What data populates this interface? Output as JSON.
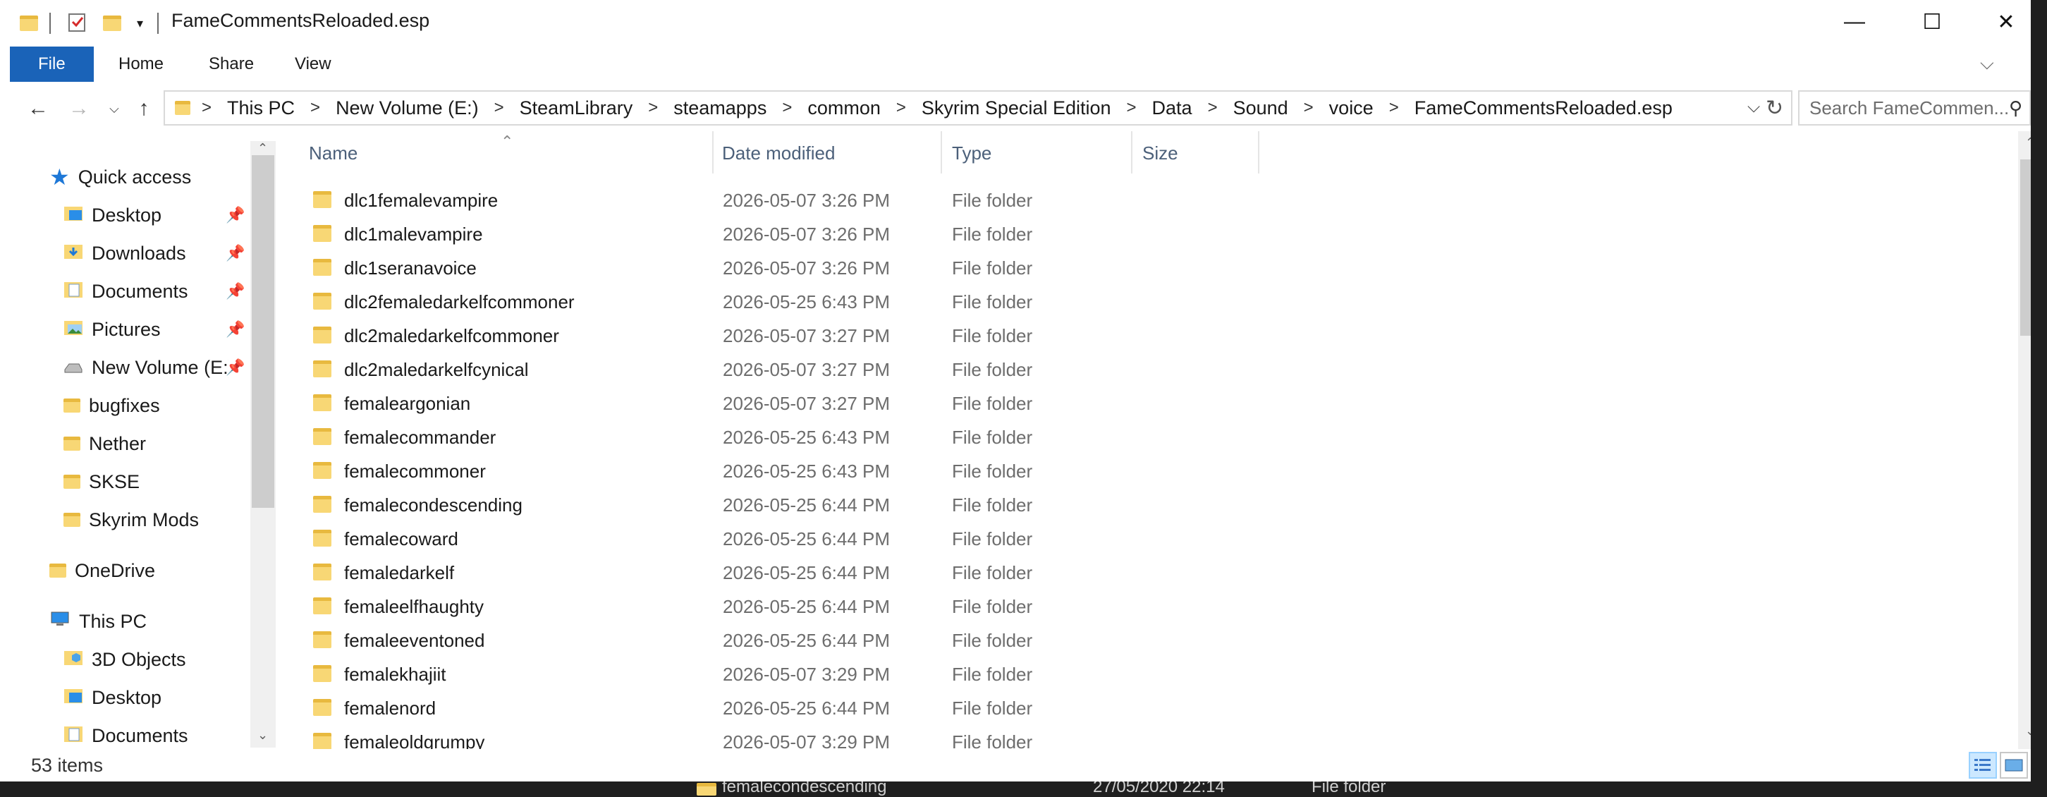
{
  "window": {
    "title": "FameCommentsReloaded.esp",
    "controls": {
      "minimize": "—",
      "maximize": "☐",
      "close": "✕"
    }
  },
  "ribbon": {
    "tabs": [
      "File",
      "Home",
      "Share",
      "View"
    ],
    "help": "?",
    "collapse": "⌵"
  },
  "address": {
    "crumbs": [
      "This PC",
      "New Volume (E:)",
      "SteamLibrary",
      "steamapps",
      "common",
      "Skyrim Special Edition",
      "Data",
      "Sound",
      "voice",
      "FameCommentsReloaded.esp"
    ],
    "separator": ">"
  },
  "search": {
    "placeholder": "Search FameCommen..."
  },
  "nav_pane": {
    "quick_access": "Quick access",
    "pinned": [
      {
        "label": "Desktop"
      },
      {
        "label": "Downloads"
      },
      {
        "label": "Documents"
      },
      {
        "label": "Pictures"
      },
      {
        "label": "New Volume (E:)"
      }
    ],
    "unpinned": [
      "bugfixes",
      "Nether",
      "SKSE",
      "Skyrim Mods"
    ],
    "onedrive": "OneDrive",
    "this_pc": "This PC",
    "this_pc_items": [
      "3D Objects",
      "Desktop",
      "Documents"
    ]
  },
  "columns": {
    "name": "Name",
    "date": "Date modified",
    "type": "Type",
    "size": "Size"
  },
  "files": [
    {
      "name": "dlc1femalevampire",
      "date": "2026-05-07 3:26 PM",
      "type": "File folder"
    },
    {
      "name": "dlc1malevampire",
      "date": "2026-05-07 3:26 PM",
      "type": "File folder"
    },
    {
      "name": "dlc1seranavoice",
      "date": "2026-05-07 3:26 PM",
      "type": "File folder"
    },
    {
      "name": "dlc2femaledarkelfcommoner",
      "date": "2026-05-25 6:43 PM",
      "type": "File folder"
    },
    {
      "name": "dlc2maledarkelfcommoner",
      "date": "2026-05-07 3:27 PM",
      "type": "File folder"
    },
    {
      "name": "dlc2maledarkelfcynical",
      "date": "2026-05-07 3:27 PM",
      "type": "File folder"
    },
    {
      "name": "femaleargonian",
      "date": "2026-05-07 3:27 PM",
      "type": "File folder"
    },
    {
      "name": "femalecommander",
      "date": "2026-05-25 6:43 PM",
      "type": "File folder"
    },
    {
      "name": "femalecommoner",
      "date": "2026-05-25 6:43 PM",
      "type": "File folder"
    },
    {
      "name": "femalecondescending",
      "date": "2026-05-25 6:44 PM",
      "type": "File folder"
    },
    {
      "name": "femalecoward",
      "date": "2026-05-25 6:44 PM",
      "type": "File folder"
    },
    {
      "name": "femaledarkelf",
      "date": "2026-05-25 6:44 PM",
      "type": "File folder"
    },
    {
      "name": "femaleelfhaughty",
      "date": "2026-05-25 6:44 PM",
      "type": "File folder"
    },
    {
      "name": "femaleeventoned",
      "date": "2026-05-25 6:44 PM",
      "type": "File folder"
    },
    {
      "name": "femalekhajiit",
      "date": "2026-05-07 3:29 PM",
      "type": "File folder"
    },
    {
      "name": "femalenord",
      "date": "2026-05-25 6:44 PM",
      "type": "File folder"
    },
    {
      "name": "femaleoldgrumpy",
      "date": "2026-05-07 3:29 PM",
      "type": "File folder"
    }
  ],
  "status": {
    "item_count": "53 items"
  },
  "background_window": {
    "name": "femalecondescending",
    "date": "27/05/2020 22:14",
    "type": "File folder"
  },
  "colors": {
    "accent": "#1a63b8",
    "folder": "#f8d775",
    "header_text": "#4c607a"
  }
}
